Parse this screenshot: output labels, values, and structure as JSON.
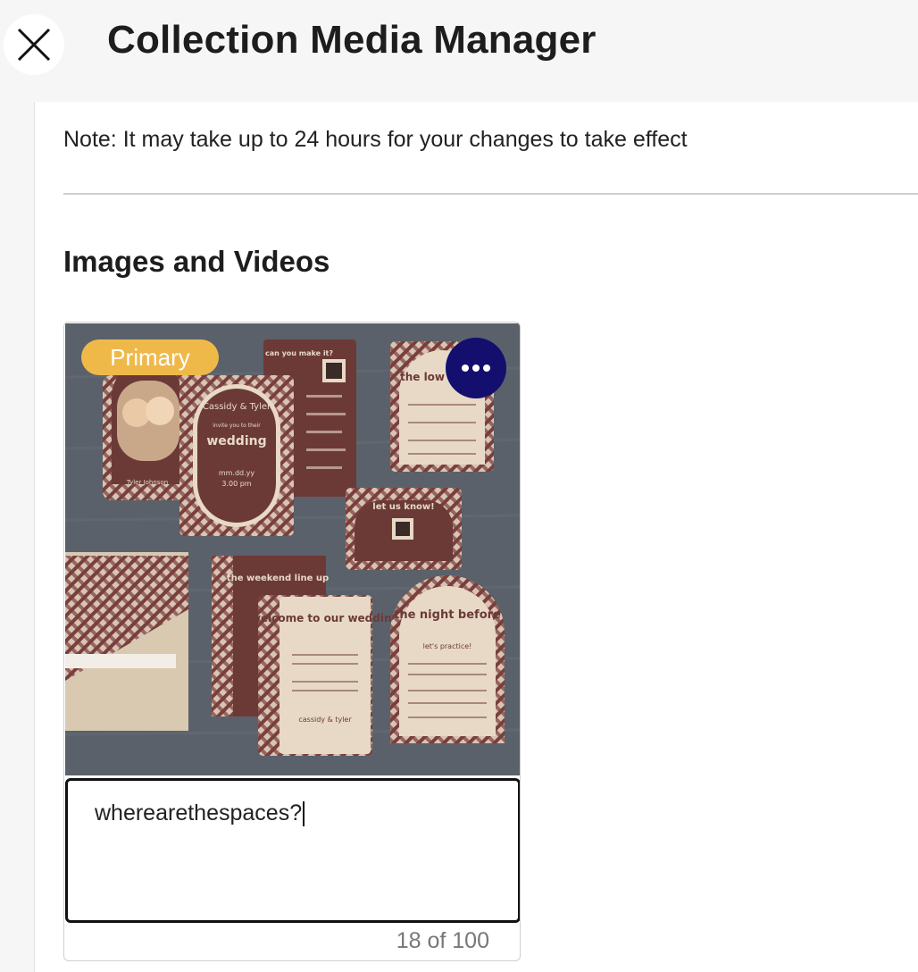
{
  "header": {
    "title": "Collection Media Manager",
    "close_icon": "close-icon"
  },
  "note": "Note: It may take up to 24 hours for your changes to take effect",
  "section": {
    "title": "Images and Videos"
  },
  "media_item": {
    "badge": "Primary",
    "more_icon": "ellipsis-icon",
    "caption_value": "wherearethespaces?",
    "counter": "18 of 100",
    "image_text": {
      "card_names": "Cassidy & Tyler",
      "card_invite": "invite you to their",
      "card_wedding": "wedding",
      "card_date": "mm.dd.yy",
      "card_time": "3.00 pm",
      "rsvp_title": "can you make it?",
      "reply_title": "let us know!",
      "weekend_title": "the weekend line up",
      "welcome_title": "welcome to our wedding",
      "welcome_sign": "cassidy & tyler",
      "night_title": "the night before",
      "night_sub": "let's practice!",
      "low_title": "the low",
      "photo_name": "Tyler Johnson"
    }
  },
  "colors": {
    "badge": "#efb94a",
    "more_button": "#140e6e",
    "card_maroon": "#6b3a37",
    "card_cream": "#e8d9c6"
  }
}
